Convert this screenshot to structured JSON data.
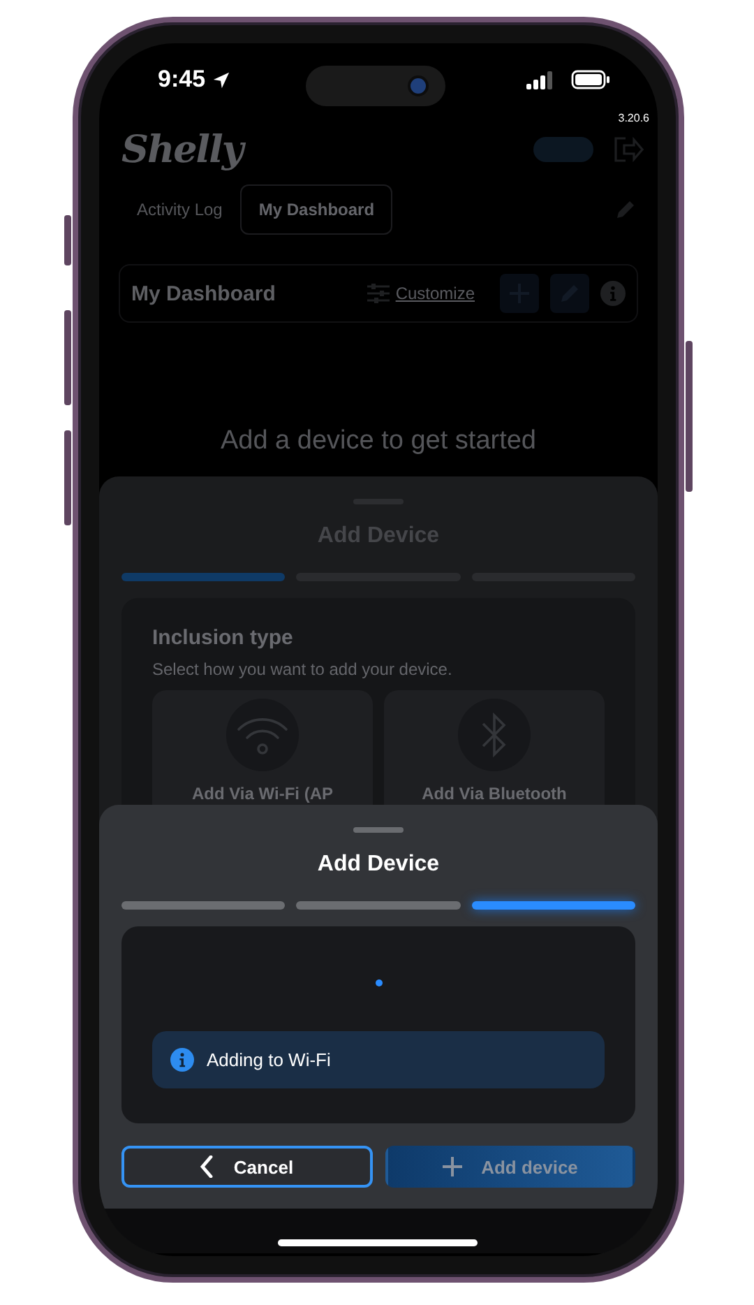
{
  "status_bar": {
    "time": "9:45",
    "version": "3.20.6"
  },
  "dashboard": {
    "logo": "Shelly",
    "tabs": [
      {
        "label": "Activity Log",
        "selected": false
      },
      {
        "label": "My Dashboard",
        "selected": true
      }
    ],
    "header": {
      "title": "My Dashboard",
      "customize": "Customize"
    },
    "empty_message": "Add a device to get started"
  },
  "sheets": [
    {
      "kind": "inclusion",
      "title": "Add Device",
      "steps": [
        {
          "active": true
        },
        {
          "active": false
        },
        {
          "active": false
        }
      ],
      "heading": "Inclusion type",
      "subtitle": "Select how you want to add your device.",
      "options": [
        {
          "label": "Add Via Wi-Fi (AP",
          "kind": "wifi"
        },
        {
          "label": "Add Via Bluetooth",
          "kind": "bluetooth"
        }
      ]
    },
    {
      "kind": "progress",
      "title": "Add Device",
      "steps": [
        {
          "active": false
        },
        {
          "active": false
        },
        {
          "active": true
        }
      ],
      "message": "Adding to Wi-Fi",
      "buttons": [
        {
          "label": "Cancel",
          "kind": "back",
          "focused": true,
          "disabled": false
        },
        {
          "label": "Add device",
          "kind": "add",
          "focused": false,
          "disabled": true
        }
      ]
    }
  ]
}
